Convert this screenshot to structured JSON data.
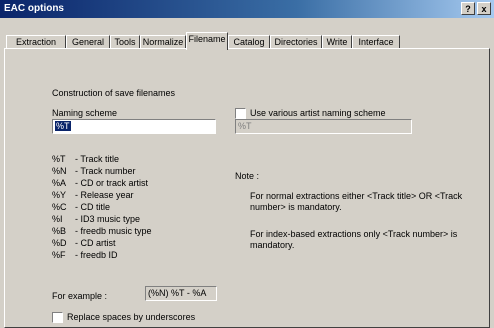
{
  "window": {
    "title": "EAC options",
    "help_btn": "?",
    "close_btn": "x"
  },
  "tabs": [
    {
      "label": "Extraction"
    },
    {
      "label": "General"
    },
    {
      "label": "Tools"
    },
    {
      "label": "Normalize"
    },
    {
      "label": "Filename"
    },
    {
      "label": "Catalog"
    },
    {
      "label": "Directories"
    },
    {
      "label": "Write"
    },
    {
      "label": "Interface"
    }
  ],
  "active_tab": "Filename",
  "panel": {
    "section_title": "Construction of save filenames",
    "naming_scheme_label": "Naming scheme",
    "naming_scheme_value": "%T",
    "various_artist_label": "Use various artist naming scheme",
    "various_artist_checked": false,
    "various_artist_value": "%T",
    "codes": [
      {
        "code": "%T",
        "desc": "- Track title"
      },
      {
        "code": "%N",
        "desc": "- Track number"
      },
      {
        "code": "%A",
        "desc": "- CD or track artist"
      },
      {
        "code": "%Y",
        "desc": "- Release year"
      },
      {
        "code": "%C",
        "desc": "- CD title"
      },
      {
        "code": "%I",
        "desc": "- ID3 music type"
      },
      {
        "code": "%B",
        "desc": "- freedb music type"
      },
      {
        "code": "%D",
        "desc": "- CD artist"
      },
      {
        "code": "%F",
        "desc": "- freedb ID"
      }
    ],
    "note_label": "Note :",
    "note1_line1": "For normal extractions either <Track title>  OR  <Track",
    "note1_line2": "number> is mandatory.",
    "note2_line1": "For index-based extractions only <Track number> is",
    "note2_line2": "mandatory.",
    "example_label": "For example :",
    "example_value": "(%N) %T - %A",
    "replace_spaces_label": "Replace spaces by underscores",
    "replace_spaces_checked": false
  }
}
